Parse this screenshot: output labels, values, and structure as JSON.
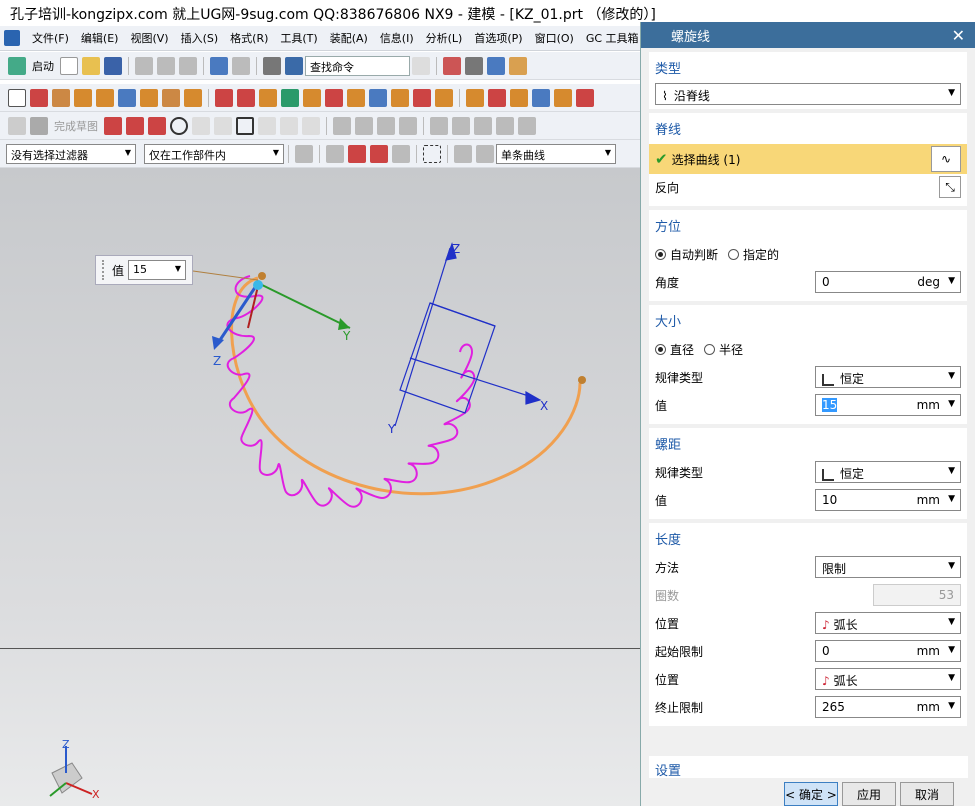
{
  "window": {
    "title": "孔子培训-kongzipx.com 就上UG网-9sug.com QQ:838676806 NX9 - 建模 - [KZ_01.prt （修改的）]"
  },
  "menu": [
    "文件(F)",
    "编辑(E)",
    "视图(V)",
    "插入(S)",
    "格式(R)",
    "工具(T)",
    "装配(A)",
    "信息(I)",
    "分析(L)",
    "首选项(P)",
    "窗口(O)",
    "GC 工具箱"
  ],
  "toolbar": {
    "start_label": "启动",
    "search_placeholder": "查找命令",
    "finish_sketch": "完成草图",
    "filter_select": "没有选择过滤器",
    "scope_select": "仅在工作部件内",
    "curve_rule": "单条曲线"
  },
  "viewport": {
    "value_box_label": "值",
    "value_box_value": "15",
    "axes": {
      "x": "X",
      "y": "Y",
      "z": "Z"
    }
  },
  "dialog": {
    "title": "螺旋线",
    "type": {
      "section": "类型",
      "value": "沿脊线"
    },
    "spine": {
      "section": "脊线",
      "select_curve": "选择曲线 (1)",
      "reverse": "反向"
    },
    "orientation": {
      "section": "方位",
      "auto": "自动判断",
      "specified": "指定的",
      "angle_label": "角度",
      "angle_value": "0",
      "angle_unit": "deg"
    },
    "size": {
      "section": "大小",
      "diameter": "直径",
      "radius": "半径",
      "law_label": "规律类型",
      "law_value": "恒定",
      "value_label": "值",
      "value": "15",
      "unit": "mm"
    },
    "pitch": {
      "section": "螺距",
      "law_label": "规律类型",
      "law_value": "恒定",
      "value_label": "值",
      "value": "10",
      "unit": "mm"
    },
    "length": {
      "section": "长度",
      "method_label": "方法",
      "method_value": "限制",
      "turns_label": "圈数",
      "turns_value": "53",
      "pos1_label": "位置",
      "pos1_value": "弧长",
      "start_label": "起始限制",
      "start_value": "0",
      "pos2_label": "位置",
      "pos2_value": "弧长",
      "end_label": "终止限制",
      "end_value": "265",
      "unit": "mm"
    },
    "settings": "设置",
    "ok": "< 确定 >",
    "apply": "应用",
    "cancel": "取消"
  }
}
